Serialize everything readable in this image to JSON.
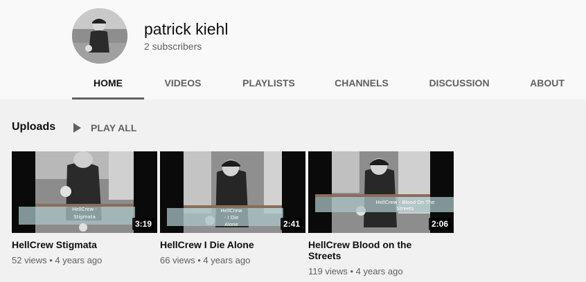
{
  "channel": {
    "name": "patrick kiehl",
    "subscribers": "2 subscribers"
  },
  "tabs": [
    {
      "label": "HOME",
      "active": true
    },
    {
      "label": "VIDEOS"
    },
    {
      "label": "PLAYLISTS"
    },
    {
      "label": "CHANNELS"
    },
    {
      "label": "DISCUSSION"
    },
    {
      "label": "ABOUT"
    }
  ],
  "uploads": {
    "title": "Uploads",
    "play_all": "PLAY ALL",
    "videos": [
      {
        "title": "HellCrew Stigmata",
        "duration": "3:19",
        "views": "52 views",
        "age": "4 years ago",
        "overlay": "HellCrew - Stigmata"
      },
      {
        "title": "HellCrew I Die Alone",
        "duration": "2:41",
        "views": "66 views",
        "age": "4 years ago",
        "overlay": "HellCrew - I Die Alone"
      },
      {
        "title": "HellCrew Blood on the Streets",
        "duration": "2:06",
        "views": "119 views",
        "age": "4 years ago",
        "overlay": "HellCrew - Blood On The Streets"
      }
    ]
  },
  "meta_separator": "•"
}
